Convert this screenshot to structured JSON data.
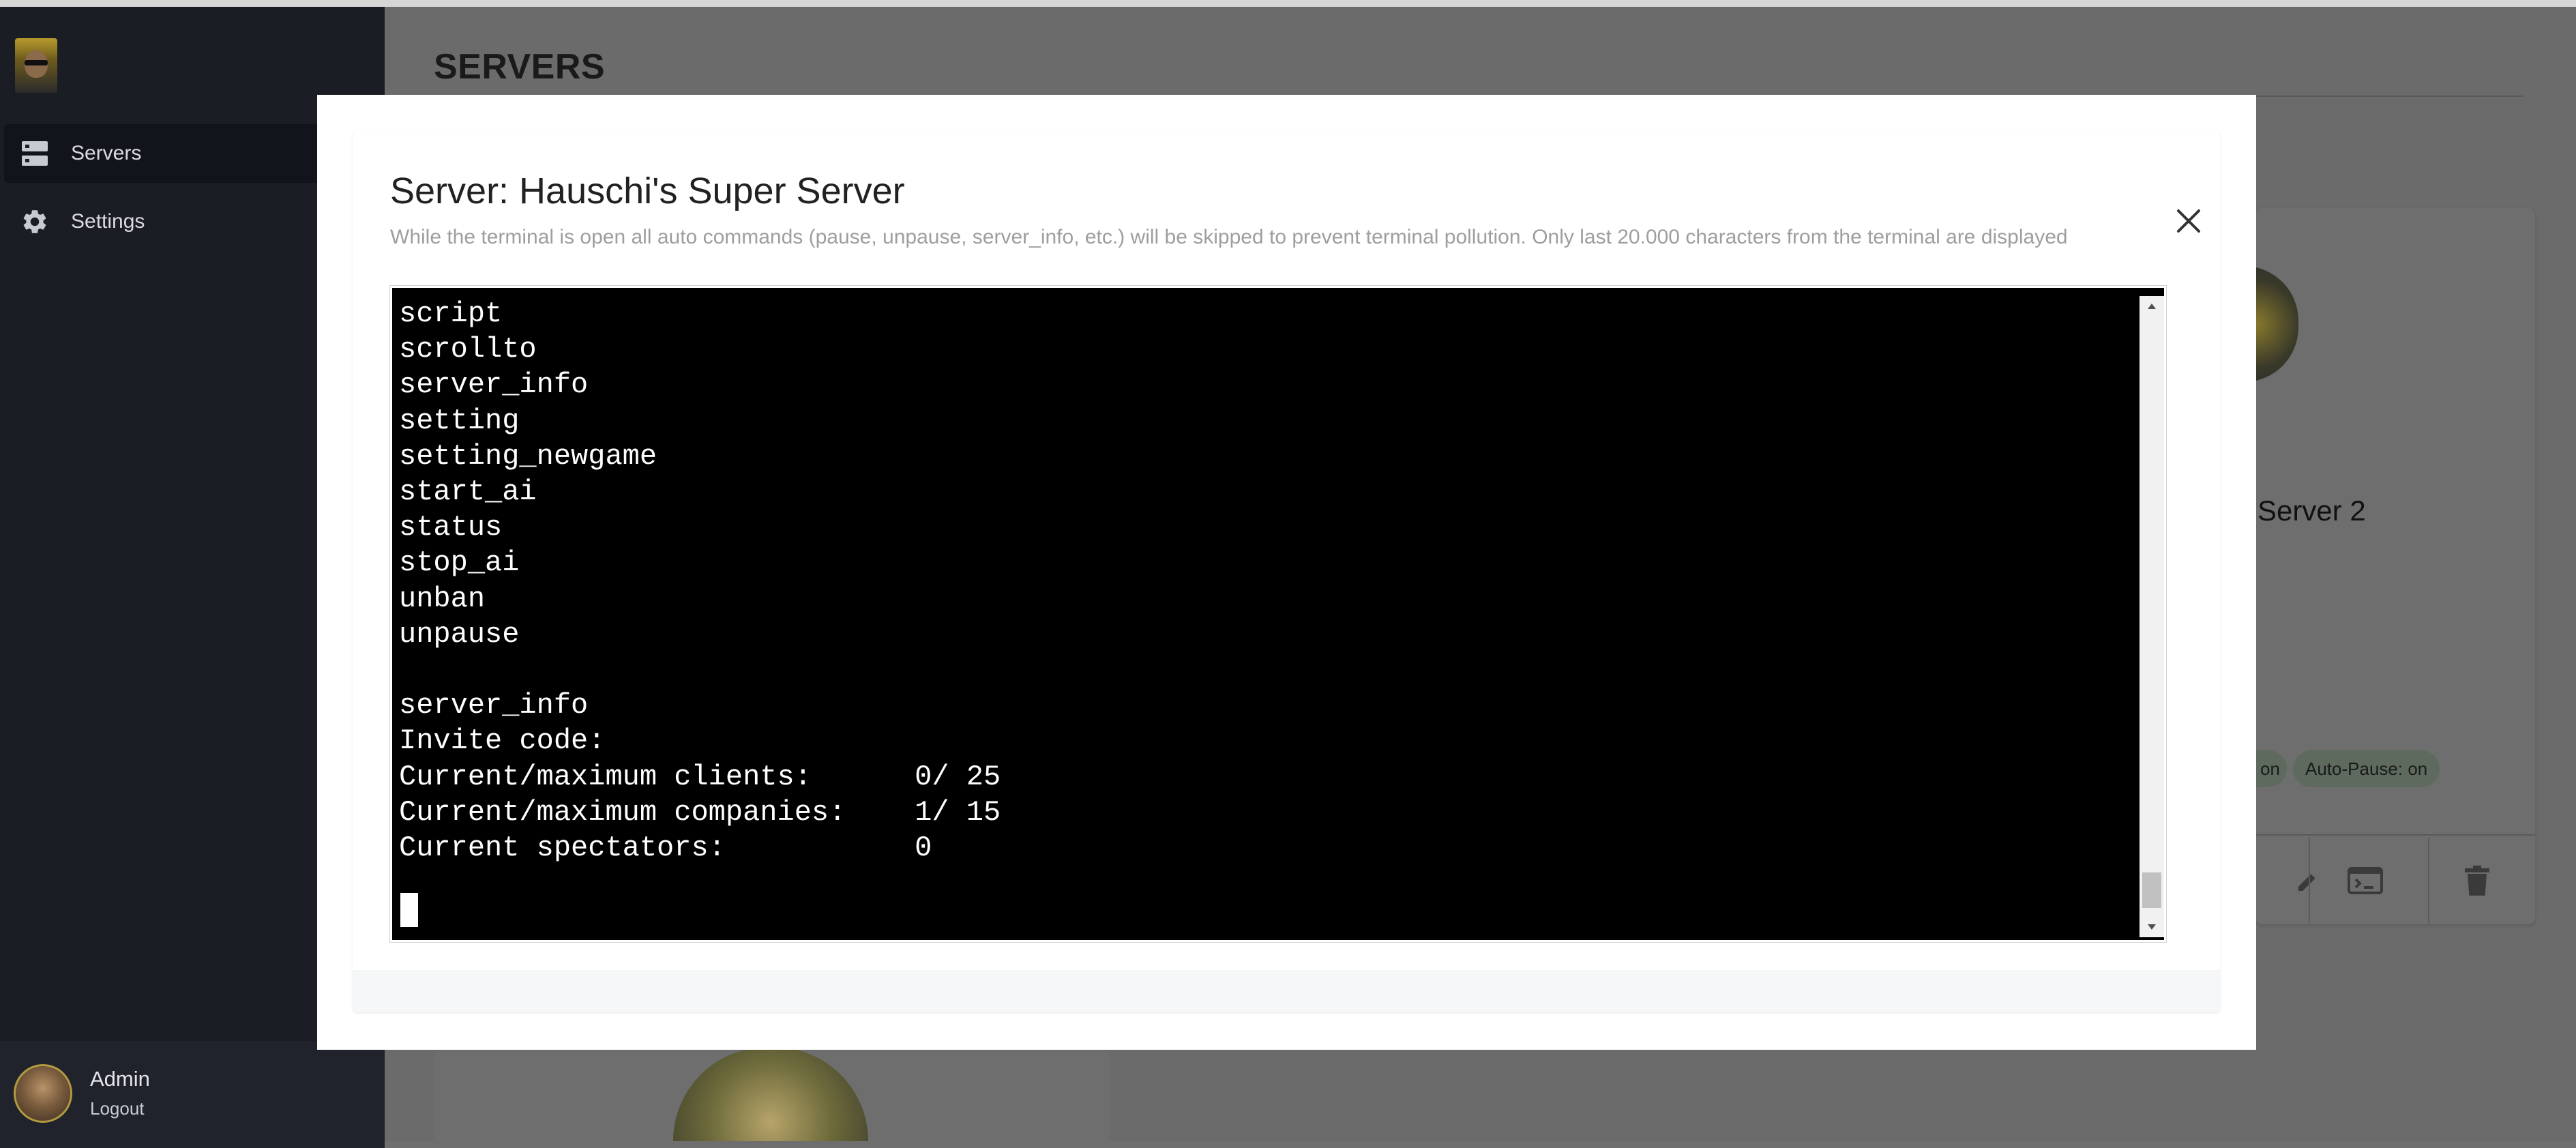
{
  "sidebar": {
    "items": [
      {
        "label": "Servers",
        "icon": "servers-icon",
        "active": true
      },
      {
        "label": "Settings",
        "icon": "gear-icon",
        "active": false
      }
    ],
    "user": {
      "name": "Admin",
      "logout_label": "Logout"
    }
  },
  "page": {
    "title": "SERVERS"
  },
  "background_card": {
    "name_fragment": "Server 2",
    "chips": [
      "on",
      "Auto-Pause: on"
    ]
  },
  "modal": {
    "title": "Server: Hauschi's Super Server",
    "subtitle": "While the terminal is open all auto commands (pause, unpause, server_info, etc.) will be skipped to prevent terminal pollution. Only last 20.000 characters from the terminal are displayed",
    "terminal_lines": [
      "script",
      "scrollto",
      "server_info",
      "setting",
      "setting_newgame",
      "start_ai",
      "status",
      "stop_ai",
      "unban",
      "unpause",
      "",
      "server_info",
      "Invite code:",
      "Current/maximum clients:      0/ 25",
      "Current/maximum companies:    1/ 15",
      "Current spectators:           0"
    ]
  },
  "colors": {
    "sidebar_bg": "#1a1d23",
    "terminal_bg": "#000000",
    "terminal_fg": "#ffffff",
    "subtitle": "#9e9e9e"
  }
}
